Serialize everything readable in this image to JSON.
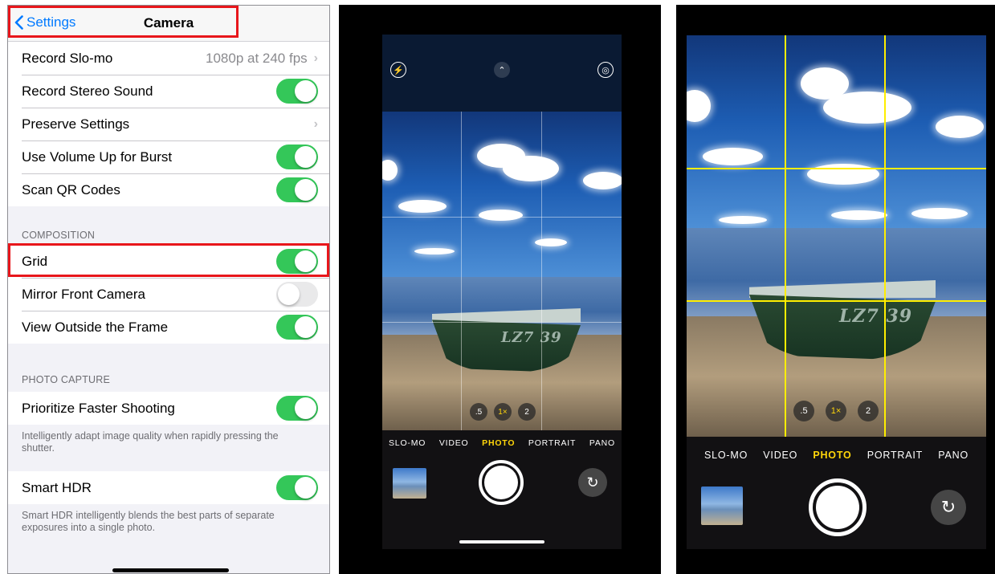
{
  "settings": {
    "back_label": "Settings",
    "title": "Camera",
    "rows_top": [
      {
        "label": "Record Slo-mo",
        "value": "1080p at 240 fps"
      },
      {
        "label": "Record Stereo Sound",
        "toggle": "on"
      },
      {
        "label": "Preserve Settings"
      },
      {
        "label": "Use Volume Up for Burst",
        "toggle": "on"
      },
      {
        "label": "Scan QR Codes",
        "toggle": "on"
      }
    ],
    "composition": {
      "header": "COMPOSITION",
      "rows": [
        {
          "label": "Grid",
          "toggle": "on"
        },
        {
          "label": "Mirror Front Camera",
          "toggle": "off"
        },
        {
          "label": "View Outside the Frame",
          "toggle": "on"
        }
      ]
    },
    "photo_capture": {
      "header": "PHOTO CAPTURE",
      "row": {
        "label": "Prioritize Faster Shooting",
        "toggle": "on"
      },
      "footer": "Intelligently adapt image quality when rapidly pressing the shutter."
    },
    "smart_hdr": {
      "row": {
        "label": "Smart HDR",
        "toggle": "on"
      },
      "footer": "Smart HDR intelligently blends the best parts of separate exposures into a single photo."
    },
    "highlight_color": "#e8161b",
    "toggle_on_color": "#34c759"
  },
  "camera": {
    "boat_number": "LZ7 39",
    "zoom_levels": [
      ".5",
      "1×",
      "2"
    ],
    "zoom_active": "1×",
    "modes_left": [
      "SLO-MO",
      "VIDEO",
      "PHOTO",
      "PORTRAIT",
      "PANO"
    ],
    "modes_right": [
      "SLO-MO",
      "VIDEO",
      "PHOTO",
      "PORTRAIT",
      "PANO"
    ],
    "active_mode": "PHOTO",
    "top_icons": [
      "flash-icon",
      "chevron-up-icon",
      "live-photo-icon"
    ],
    "grid_color_left": "#ffffff",
    "grid_color_right": "#ffee00",
    "accent_yellow": "#ffd60a"
  }
}
